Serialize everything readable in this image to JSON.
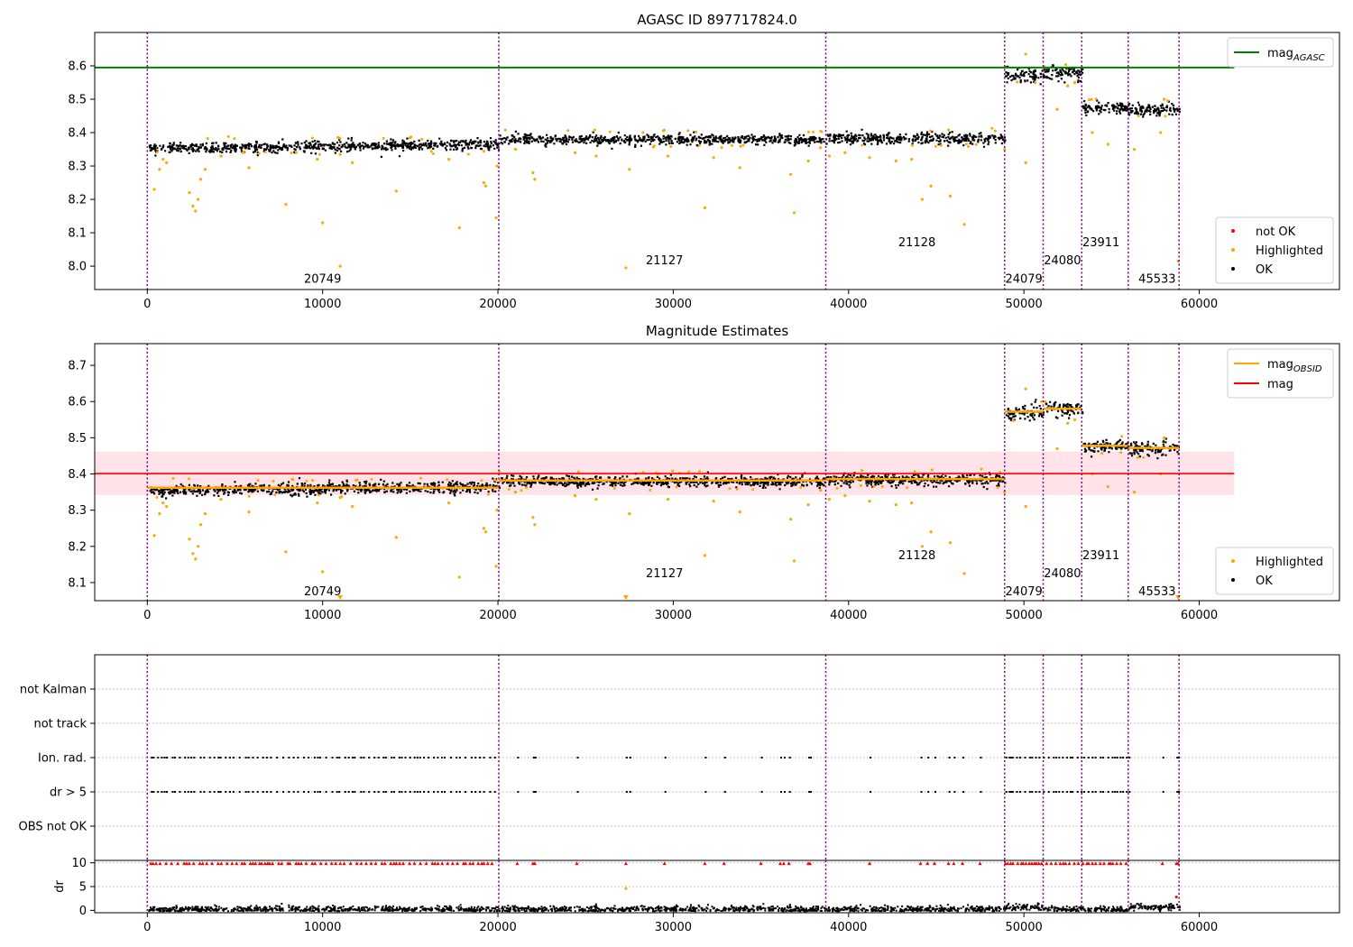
{
  "figure": {
    "colors": {
      "ok": "#000000",
      "highlighted": "#ffa500",
      "not_ok": "#ff0000",
      "mag_agasc": "#008000",
      "mag": "#ff0000",
      "mag_obsid": "#ffa500",
      "obs_boundary": "#800080",
      "band": "#ffc0cb"
    }
  },
  "chart_data": [
    {
      "type": "scatter",
      "id": "top",
      "title": "AGASC ID 897717824.0",
      "xlim": [
        -3000,
        68000
      ],
      "ylim": [
        7.93,
        8.7
      ],
      "xticks": [
        0,
        10000,
        20000,
        30000,
        40000,
        50000,
        60000
      ],
      "yticks": [
        8.0,
        8.1,
        8.2,
        8.3,
        8.4,
        8.5,
        8.6
      ],
      "ytick_labels": [
        "8.0",
        "8.1",
        "8.2",
        "8.3",
        "8.4",
        "8.5",
        "8.6"
      ],
      "mag_agasc": 8.595,
      "mag_line_xmax": 62000,
      "legend_lines": [
        {
          "label": "mag",
          "sub": "AGASC",
          "color": "#008000"
        }
      ],
      "legend_points": [
        "not OK",
        "Highlighted",
        "OK"
      ],
      "obs_labels": [
        {
          "text": "20749",
          "x": 10000,
          "y": 7.95
        },
        {
          "text": "21127",
          "x": 29500,
          "y": 8.005
        },
        {
          "text": "21128",
          "x": 43900,
          "y": 8.06
        },
        {
          "text": "24079",
          "x": 50000,
          "y": 7.95
        },
        {
          "text": "24080",
          "x": 52200,
          "y": 8.005
        },
        {
          "text": "23911",
          "x": 54400,
          "y": 8.06
        },
        {
          "text": "45533",
          "x": 57600,
          "y": 7.95
        }
      ]
    },
    {
      "type": "scatter",
      "id": "middle",
      "title": "Magnitude Estimates",
      "xlim": [
        -3000,
        68000
      ],
      "ylim": [
        8.05,
        8.76
      ],
      "xticks": [
        0,
        10000,
        20000,
        30000,
        40000,
        50000,
        60000
      ],
      "yticks": [
        8.1,
        8.2,
        8.3,
        8.4,
        8.5,
        8.6,
        8.7
      ],
      "ytick_labels": [
        "8.1",
        "8.2",
        "8.3",
        "8.4",
        "8.5",
        "8.6",
        "8.7"
      ],
      "mag": 8.401,
      "band": [
        8.342,
        8.462
      ],
      "mag_line_xmax": 62000,
      "legend_lines": [
        {
          "label": "mag",
          "sub": "OBSID",
          "color": "#ffa500"
        },
        {
          "label": "mag",
          "sub": "",
          "color": "#ff0000"
        }
      ],
      "legend_points": [
        "Highlighted",
        "OK"
      ],
      "obs_labels": [
        {
          "text": "20749",
          "x": 10000,
          "y": 8.065
        },
        {
          "text": "21127",
          "x": 29500,
          "y": 8.115
        },
        {
          "text": "21128",
          "x": 43900,
          "y": 8.165
        },
        {
          "text": "24079",
          "x": 50000,
          "y": 8.065
        },
        {
          "text": "24080",
          "x": 52200,
          "y": 8.115
        },
        {
          "text": "23911",
          "x": 54400,
          "y": 8.165
        },
        {
          "text": "45533",
          "x": 57600,
          "y": 8.065
        }
      ]
    },
    {
      "type": "scatter",
      "id": "flags",
      "xlim": [
        -3000,
        68000
      ],
      "categories": [
        "not Kalman",
        "not track",
        "Ion. rad.",
        "dr > 5",
        "OBS not OK"
      ]
    },
    {
      "type": "scatter",
      "id": "dr",
      "ylabel": "dr",
      "xlim": [
        -3000,
        68000
      ],
      "ylim": [
        -0.5,
        10.5
      ],
      "xticks": [
        0,
        10000,
        20000,
        30000,
        40000,
        50000,
        60000
      ],
      "yticks": [
        0,
        5,
        10
      ],
      "ytick_labels": [
        "0",
        "5",
        "10"
      ],
      "xtick_labels": [
        "0",
        "10000",
        "20000",
        "30000",
        "40000",
        "50000",
        "60000"
      ]
    }
  ],
  "observations": [
    {
      "obsid": "20749",
      "start": 0,
      "end": 20050,
      "mag": 8.362,
      "scatter": 0.008,
      "trend": 0.012
    },
    {
      "obsid": "21127",
      "start": 20050,
      "end": 38700,
      "mag": 8.382,
      "scatter": 0.007,
      "trend": 0.0
    },
    {
      "obsid": "21128",
      "start": 38700,
      "end": 48900,
      "mag": 8.386,
      "scatter": 0.008,
      "trend": 0.0
    },
    {
      "obsid": "24079",
      "start": 48900,
      "end": 51100,
      "mag": 8.572,
      "scatter": 0.012,
      "trend": 0.0
    },
    {
      "obsid": "24080",
      "start": 51100,
      "end": 53300,
      "mag": 8.58,
      "scatter": 0.01,
      "trend": 0.0
    },
    {
      "obsid": "23911",
      "start": 53300,
      "end": 55950,
      "mag": 8.478,
      "scatter": 0.008,
      "trend": 0.0
    },
    {
      "obsid": "45533",
      "start": 55950,
      "end": 58850,
      "mag": 8.472,
      "scatter": 0.01,
      "trend": 0.0
    }
  ],
  "obs_boundaries": [
    0,
    20050,
    38700,
    48900,
    51100,
    53300,
    55950,
    58850
  ],
  "highlighted_points": [
    [
      400,
      8.23
    ],
    [
      700,
      8.29
    ],
    [
      900,
      8.32
    ],
    [
      1100,
      8.31
    ],
    [
      2400,
      8.22
    ],
    [
      2600,
      8.18
    ],
    [
      2750,
      8.165
    ],
    [
      2900,
      8.2
    ],
    [
      3050,
      8.26
    ],
    [
      3300,
      8.29
    ],
    [
      4200,
      8.33
    ],
    [
      5800,
      8.295
    ],
    [
      7900,
      8.185
    ],
    [
      9700,
      8.32
    ],
    [
      10000,
      8.13
    ],
    [
      11000,
      8.335
    ],
    [
      11700,
      8.31
    ],
    [
      14200,
      8.225
    ],
    [
      17200,
      8.32
    ],
    [
      17800,
      8.115
    ],
    [
      19200,
      8.25
    ],
    [
      19300,
      8.24
    ],
    [
      19900,
      8.145
    ],
    [
      19950,
      8.3
    ],
    [
      21000,
      8.35
    ],
    [
      22000,
      8.28
    ],
    [
      22100,
      8.26
    ],
    [
      24400,
      8.34
    ],
    [
      25600,
      8.33
    ],
    [
      27300,
      7.995
    ],
    [
      27500,
      8.29
    ],
    [
      29700,
      8.33
    ],
    [
      31800,
      8.175
    ],
    [
      32300,
      8.325
    ],
    [
      33800,
      8.295
    ],
    [
      36700,
      8.275
    ],
    [
      36900,
      8.16
    ],
    [
      37700,
      8.315
    ],
    [
      38400,
      8.355
    ],
    [
      38900,
      8.33
    ],
    [
      39800,
      8.34
    ],
    [
      41200,
      8.325
    ],
    [
      42700,
      8.315
    ],
    [
      43600,
      8.32
    ],
    [
      44200,
      8.2
    ],
    [
      44700,
      8.24
    ],
    [
      45800,
      8.21
    ],
    [
      46600,
      8.125
    ],
    [
      48900,
      8.35
    ],
    [
      50100,
      8.31
    ],
    [
      50100,
      8.635
    ],
    [
      51900,
      8.47
    ],
    [
      52500,
      8.54
    ],
    [
      52900,
      8.55
    ],
    [
      53900,
      8.4
    ],
    [
      54800,
      8.365
    ],
    [
      56300,
      8.35
    ],
    [
      57800,
      8.4
    ],
    [
      58000,
      8.5
    ],
    [
      58800,
      8.015
    ],
    [
      11000,
      8.0
    ]
  ]
}
